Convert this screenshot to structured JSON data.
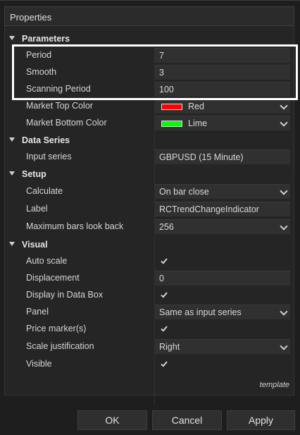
{
  "window": {
    "title": "Properties"
  },
  "categories": [
    {
      "label": "Parameters",
      "rows": [
        {
          "label": "Period",
          "value": "7",
          "kind": "text"
        },
        {
          "label": "Smooth",
          "value": "3",
          "kind": "text"
        },
        {
          "label": "Scanning Period",
          "value": "100",
          "kind": "text"
        },
        {
          "label": "Market Top Color",
          "value": "Red",
          "kind": "color",
          "color": "#ff0000"
        },
        {
          "label": "Market Bottom Color",
          "value": "Lime",
          "kind": "color",
          "color": "#00ff00"
        }
      ]
    },
    {
      "label": "Data Series",
      "rows": [
        {
          "label": "Input series",
          "value": "GBPUSD (15 Minute)",
          "kind": "text"
        }
      ]
    },
    {
      "label": "Setup",
      "rows": [
        {
          "label": "Calculate",
          "value": "On bar close",
          "kind": "dropdown"
        },
        {
          "label": "Label",
          "value": "RCTrendChangeIndicator",
          "kind": "text"
        },
        {
          "label": "Maximum bars look back",
          "value": "256",
          "kind": "dropdown"
        }
      ]
    },
    {
      "label": "Visual",
      "rows": [
        {
          "label": "Auto scale",
          "value": true,
          "kind": "checkbox"
        },
        {
          "label": "Displacement",
          "value": "0",
          "kind": "text"
        },
        {
          "label": "Display in Data Box",
          "value": true,
          "kind": "checkbox"
        },
        {
          "label": "Panel",
          "value": "Same as input series",
          "kind": "dropdown"
        },
        {
          "label": "Price marker(s)",
          "value": true,
          "kind": "checkbox"
        },
        {
          "label": "Scale justification",
          "value": "Right",
          "kind": "dropdown"
        },
        {
          "label": "Visible",
          "value": true,
          "kind": "checkbox"
        }
      ]
    }
  ],
  "template_link": "template",
  "buttons": {
    "ok": "OK",
    "cancel": "Cancel",
    "apply": "Apply"
  },
  "colors": {
    "background": "#1e1e1e",
    "panel": "#252525",
    "field": "#303030",
    "highlight": "#ffffff"
  }
}
